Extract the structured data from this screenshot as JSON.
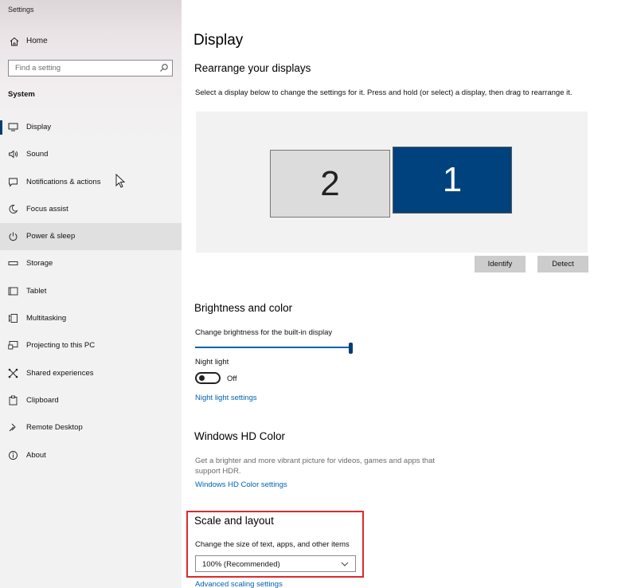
{
  "app": {
    "title": "Settings"
  },
  "sidebar": {
    "home_label": "Home",
    "search_placeholder": "Find a setting",
    "section_title": "System",
    "items": [
      {
        "label": "Display",
        "icon": "monitor-icon"
      },
      {
        "label": "Sound",
        "icon": "speaker-icon"
      },
      {
        "label": "Notifications & actions",
        "icon": "notification-icon"
      },
      {
        "label": "Focus assist",
        "icon": "moon-icon"
      },
      {
        "label": "Power & sleep",
        "icon": "power-icon"
      },
      {
        "label": "Storage",
        "icon": "storage-icon"
      },
      {
        "label": "Tablet",
        "icon": "tablet-icon"
      },
      {
        "label": "Multitasking",
        "icon": "multitasking-icon"
      },
      {
        "label": "Projecting to this PC",
        "icon": "projecting-icon"
      },
      {
        "label": "Shared experiences",
        "icon": "shared-icon"
      },
      {
        "label": "Clipboard",
        "icon": "clipboard-icon"
      },
      {
        "label": "Remote Desktop",
        "icon": "remote-desktop-icon"
      },
      {
        "label": "About",
        "icon": "info-icon"
      }
    ]
  },
  "main": {
    "title": "Display",
    "rearrange": {
      "heading": "Rearrange your displays",
      "description": "Select a display below to change the settings for it. Press and hold (or select) a display, then drag to rearrange it.",
      "monitor_2": "2",
      "monitor_1": "1",
      "identify_label": "Identify",
      "detect_label": "Detect"
    },
    "brightness": {
      "heading": "Brightness and color",
      "slider_label": "Change brightness for the built-in display",
      "brightness_value": 1.0,
      "night_light_label": "Night light",
      "night_light_state": "Off",
      "night_light_link": "Night light settings"
    },
    "hdr": {
      "heading": "Windows HD Color",
      "description": "Get a brighter and more vibrant picture for videos, games and apps that support HDR.",
      "link": "Windows HD Color settings"
    },
    "scale": {
      "heading": "Scale and layout",
      "label": "Change the size of text, apps, and other items",
      "value": "100% (Recommended)",
      "advanced_link": "Advanced scaling settings"
    }
  },
  "colors": {
    "accent": "#0063b1",
    "monitor_selected": "#00427d",
    "highlight_box": "#e0282a"
  }
}
